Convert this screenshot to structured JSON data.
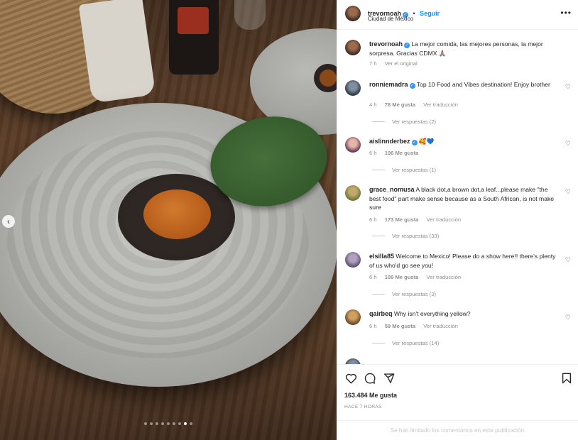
{
  "post": {
    "author": "trevornoah",
    "follow_label": "Seguir",
    "dot": "•",
    "location": "Ciudad de México",
    "more": "•••",
    "caption": {
      "text": "La mejor comida, las mejores personas, la mejor sorpresa. Gracias CDMX",
      "time": "7 h",
      "see_original": "Ver el original"
    },
    "carousel": {
      "slides": 9,
      "active": 8
    }
  },
  "comments": [
    {
      "user": "ronniemadra",
      "verified": true,
      "text": "Top 10 Food and Vibes destination! Enjoy brother",
      "time": "4 h",
      "likes": "78 Me gusta",
      "translate": "Ver traducción",
      "replies": "Ver respuestas (2)"
    },
    {
      "user": "aislinnderbez",
      "verified": true,
      "text": "🥰💙",
      "time": "6 h",
      "likes": "106 Me gusta",
      "translate": "",
      "replies": "Ver respuestas (1)"
    },
    {
      "user": "grace_nomusa",
      "verified": false,
      "text": "A black dot,a brown dot,a leaf...please make \"the best food\" part make sense because as a South African, is not make sure",
      "time": "6 h",
      "likes": "173 Me gusta",
      "translate": "Ver traducción",
      "replies": "Ver respuestas (33)"
    },
    {
      "user": "elsilla85",
      "verified": false,
      "text": "Welcome to Mexico! Please do a show here!! there's plenty of us who'd go see you!",
      "time": "6 h",
      "likes": "109 Me gusta",
      "translate": "Ver traducción",
      "replies": "Ver respuestas (3)"
    },
    {
      "user": "qairbeq",
      "verified": false,
      "text": "Why isn't everything yellow?",
      "time": "6 h",
      "likes": "59 Me gusta",
      "translate": "Ver traducción",
      "replies": "Ver respuestas (14)"
    }
  ],
  "footer": {
    "likes": "163.484 Me gusta",
    "time": "HACE 7 HORAS",
    "limited": "Se han limitado los comentarios en esta publicación."
  },
  "colors": {
    "accent": "#0095f6",
    "verified": "#3897f0",
    "muted": "#8e8e8e"
  },
  "icons": {
    "like": "heart-icon",
    "comment": "comment-bubble-icon",
    "share": "paper-plane-icon",
    "save": "bookmark-icon",
    "prev": "chevron-left-icon"
  }
}
